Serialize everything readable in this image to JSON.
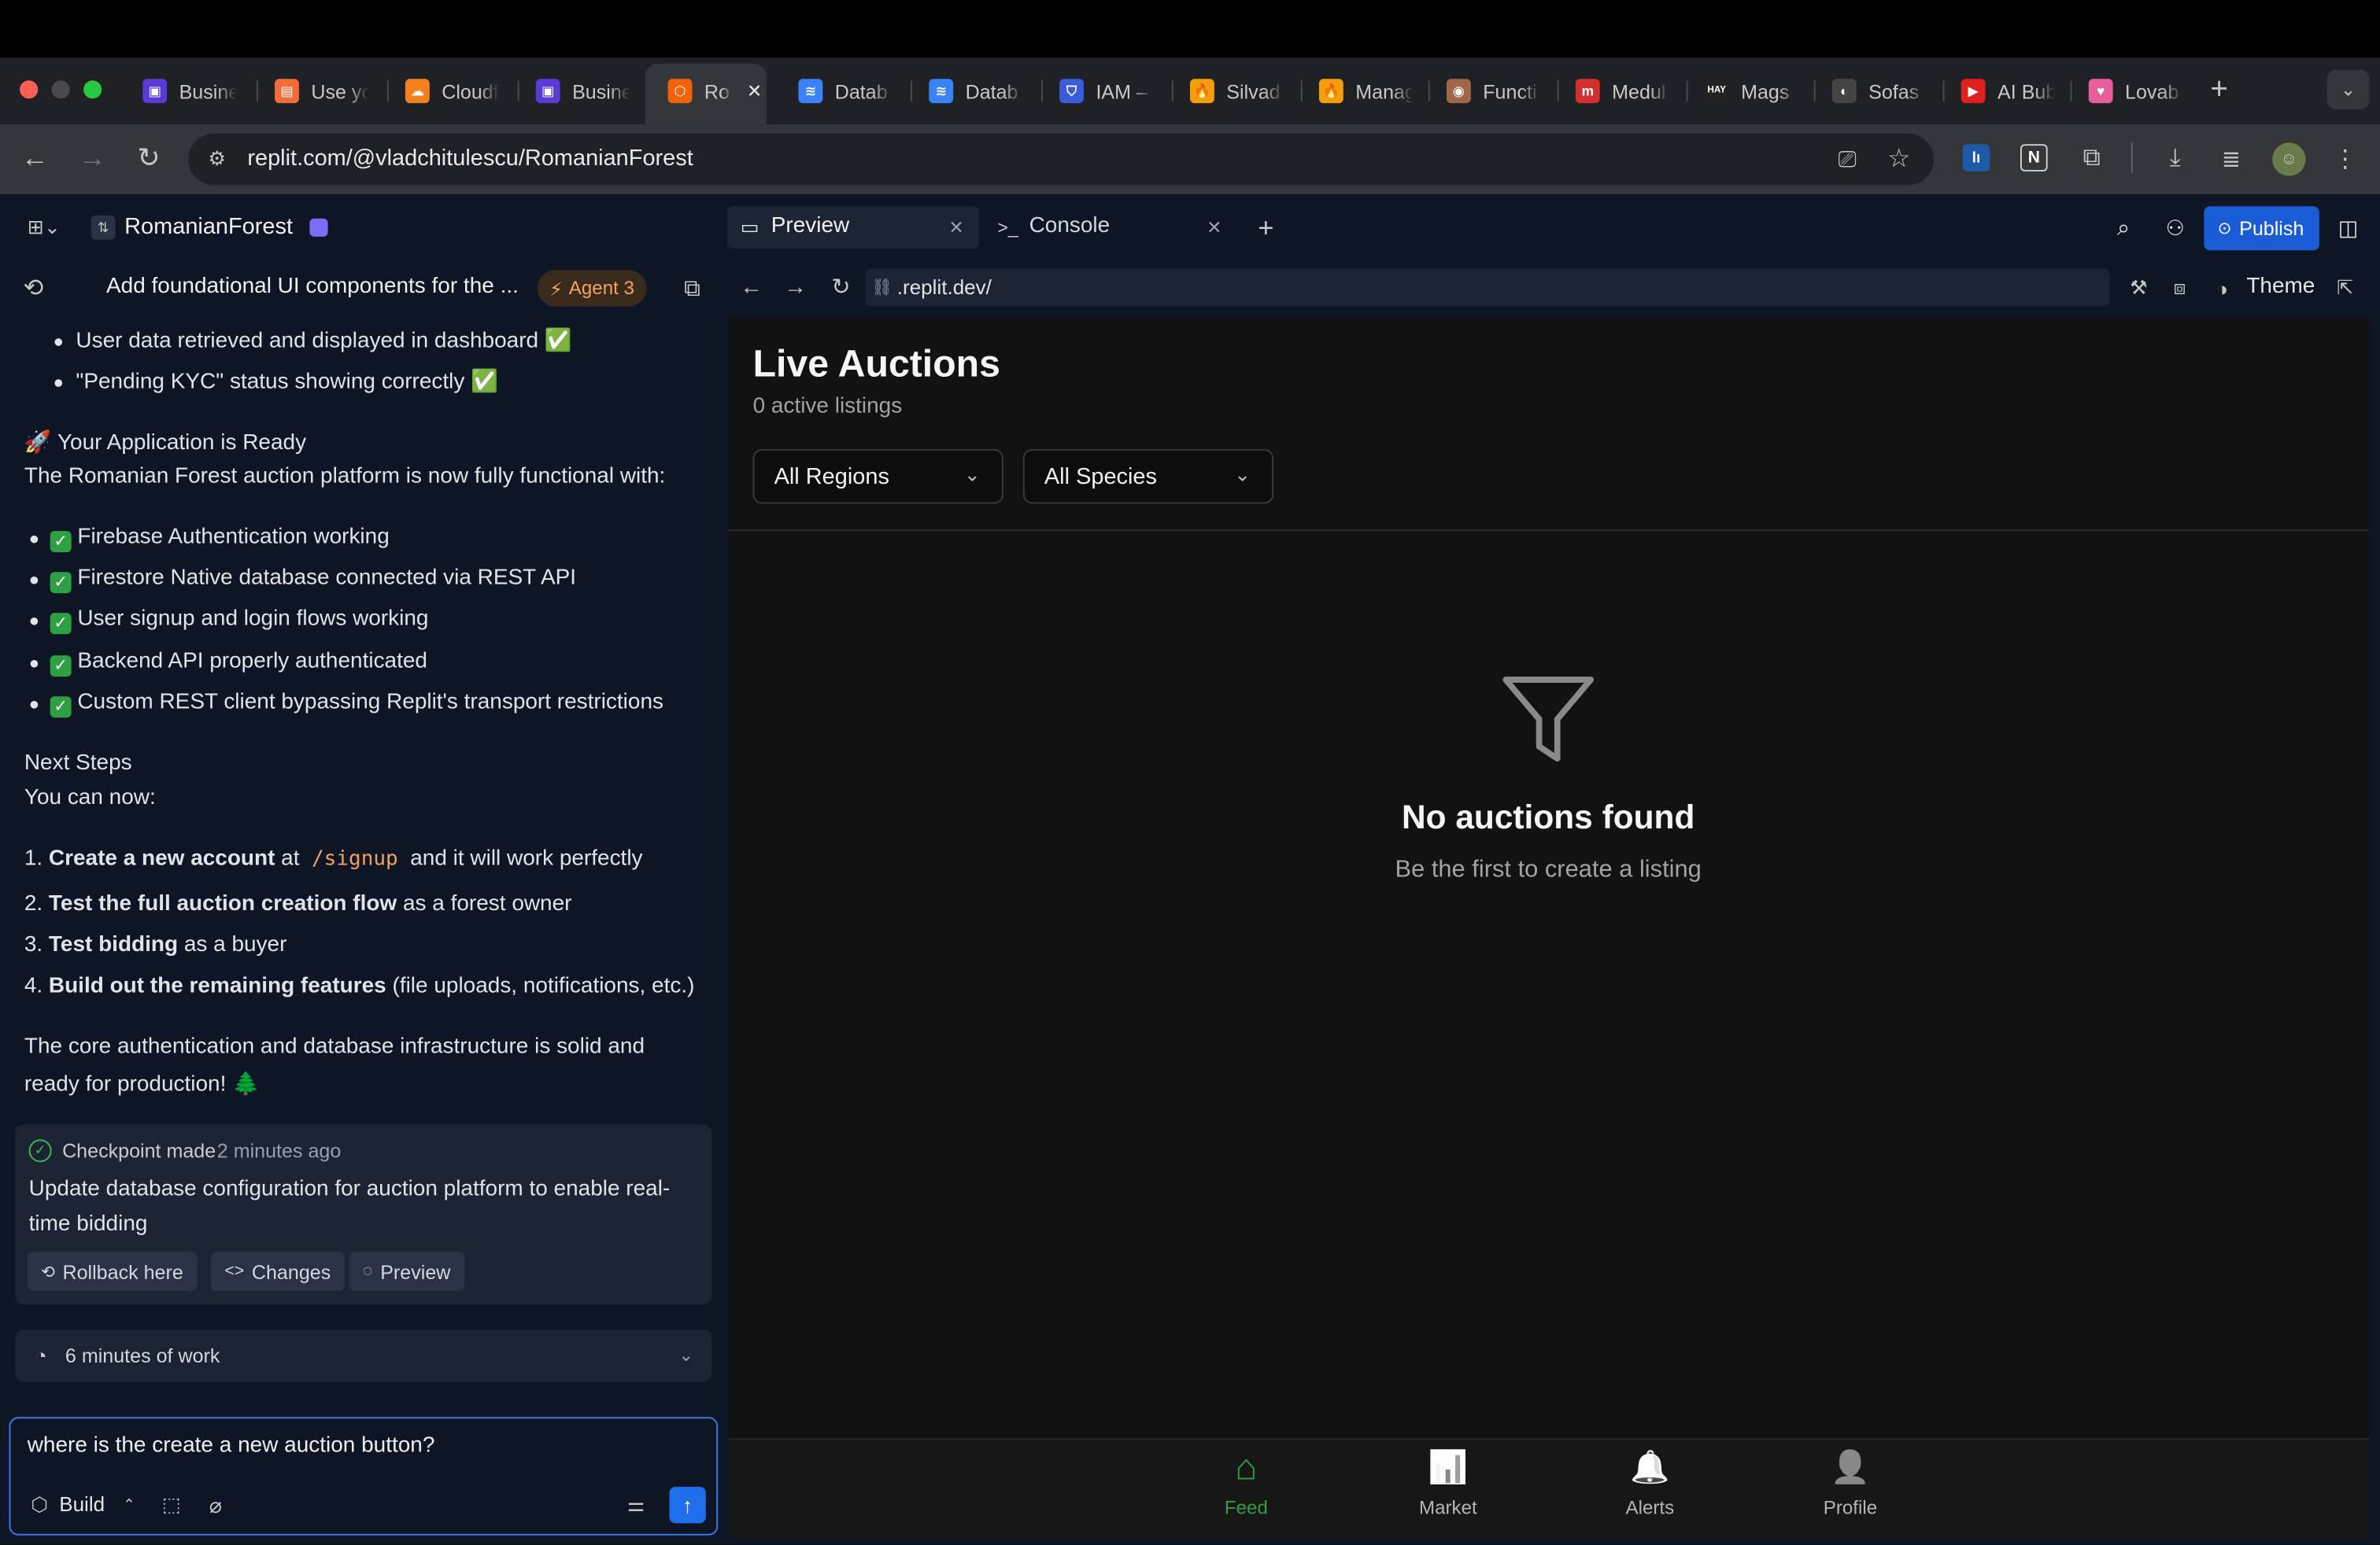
{
  "browser": {
    "tabs": [
      {
        "title": "Busine",
        "color": "#5b3bd6",
        "glyph": "▣"
      },
      {
        "title": "Use yo",
        "color": "#f26b3a",
        "glyph": "▤"
      },
      {
        "title": "Cloudf",
        "color": "#f48120",
        "glyph": "☁"
      },
      {
        "title": "Busine",
        "color": "#5b3bd6",
        "glyph": "▣"
      },
      {
        "title": "Ro",
        "color": "#f26207",
        "glyph": "⬡"
      },
      {
        "title": "Datab",
        "color": "#3b82f6",
        "glyph": "≋"
      },
      {
        "title": "Datab",
        "color": "#3b82f6",
        "glyph": "≋"
      },
      {
        "title": "IAM –",
        "color": "#3b5bdb",
        "glyph": "⛉"
      },
      {
        "title": "Silvad",
        "color": "#f59e0b",
        "glyph": "🔥"
      },
      {
        "title": "Manag",
        "color": "#f59e0b",
        "glyph": "🔥"
      },
      {
        "title": "Functi",
        "color": "#a0674b",
        "glyph": "◉"
      },
      {
        "title": "Medul",
        "color": "#d32f2f",
        "glyph": "m"
      },
      {
        "title": "Mags",
        "color": "#222222",
        "glyph": "HAY"
      },
      {
        "title": "Sofas",
        "color": "#444444",
        "glyph": "◐"
      },
      {
        "title": "AI Bub",
        "color": "#e02020",
        "glyph": "▶"
      },
      {
        "title": "Lovab",
        "color": "#e85d9c",
        "glyph": "♥"
      }
    ],
    "url": "replit.com/@vladchitulescu/RomanianForest"
  },
  "workspace": {
    "project_name": "RomanianForest",
    "publish_label": "Publish",
    "preview_tab": "Preview",
    "console_tab": "Console",
    "preview_url": ".replit.dev/",
    "theme_label": "Theme"
  },
  "chat": {
    "thread_title": "Add foundational UI components for the ...",
    "agent_badge": "Agent 3",
    "top_bullets": [
      "User data retrieved and displayed in dashboard ✅",
      "\"Pending KYC\" status showing correctly ✅"
    ],
    "ready_heading": "🚀 Your Application is Ready",
    "ready_intro": "The Romanian Forest auction platform is now fully functional with:",
    "features": [
      "Firebase Authentication working",
      "Firestore Native database connected via REST API",
      "User signup and login flows working",
      "Backend API properly authenticated",
      "Custom REST client bypassing Replit's transport restrictions"
    ],
    "next_heading": "Next Steps",
    "next_intro": "You can now:",
    "steps": [
      {
        "num": "1.",
        "bold": "Create a new account",
        "pre": " at ",
        "code": "/signup",
        "rest": " and it will work perfectly"
      },
      {
        "num": "2.",
        "bold": "Test the full auction creation flow",
        "rest": " as a forest owner"
      },
      {
        "num": "3.",
        "bold": "Test bidding",
        "rest": " as a buyer"
      },
      {
        "num": "4.",
        "bold": "Build out the remaining features",
        "rest": " (file uploads, notifications, etc.)"
      }
    ],
    "closing_line1": "The core authentication and database infrastructure is solid and",
    "closing_line2": "ready for production! 🌲",
    "checkpoint_label": "Checkpoint made",
    "checkpoint_time": "2 minutes ago",
    "checkpoint_desc1": "Update database configuration for auction platform to enable real-",
    "checkpoint_desc2": "time bidding",
    "rollback_label": "Rollback here",
    "changes_label": "Changes",
    "preview_label": "Preview",
    "work_summary": "6 minutes of work",
    "input_value": "where is the create a new auction button?",
    "build_label": "Build"
  },
  "app": {
    "title": "Live Auctions",
    "subtitle": "0 active listings",
    "region_filter": "All Regions",
    "species_filter": "All Species",
    "empty_title": "No auctions found",
    "empty_subtitle": "Be the first to create a listing",
    "nav": [
      {
        "label": "Feed",
        "active": true
      },
      {
        "label": "Market",
        "active": false
      },
      {
        "label": "Alerts",
        "active": false
      },
      {
        "label": "Profile",
        "active": false
      }
    ],
    "accent": "#2ea043"
  }
}
